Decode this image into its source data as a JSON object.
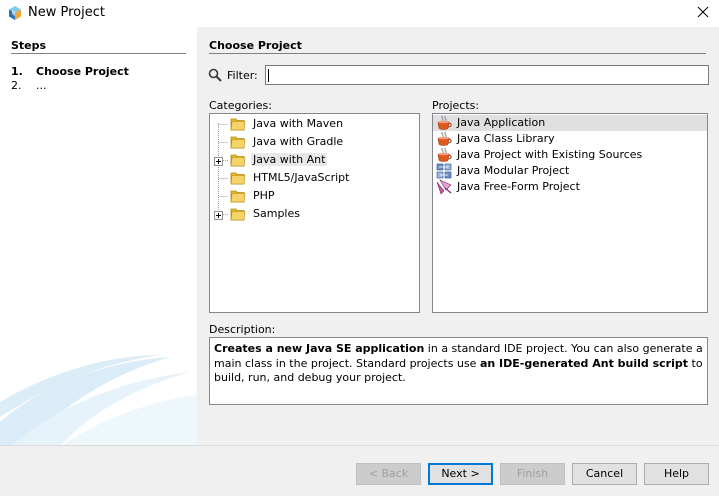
{
  "window": {
    "title": "New Project",
    "icons": {
      "app": "netbeans-cube-icon",
      "close": "close-icon"
    }
  },
  "steps": {
    "title": "Steps",
    "items": [
      {
        "num": "1.",
        "label": "Choose Project",
        "active": true
      },
      {
        "num": "2.",
        "label": "...",
        "active": false
      }
    ]
  },
  "main": {
    "section_title": "Choose Project",
    "filter": {
      "label": "Filter:",
      "value": "",
      "icon": "search-icon"
    },
    "categories_label": "Categories:",
    "projects_label": "Projects:",
    "categories": [
      {
        "label": "Java with Maven",
        "expandable": false,
        "selected": false
      },
      {
        "label": "Java with Gradle",
        "expandable": false,
        "selected": false
      },
      {
        "label": "Java with Ant",
        "expandable": true,
        "selected": true
      },
      {
        "label": "HTML5/JavaScript",
        "expandable": false,
        "selected": false
      },
      {
        "label": "PHP",
        "expandable": false,
        "selected": false
      },
      {
        "label": "Samples",
        "expandable": true,
        "selected": false
      }
    ],
    "projects": [
      {
        "label": "Java Application",
        "icon": "coffee-cup-icon",
        "selected": true
      },
      {
        "label": "Java Class Library",
        "icon": "coffee-cup-icon",
        "selected": false
      },
      {
        "label": "Java Project with Existing Sources",
        "icon": "coffee-cup-icon",
        "selected": false
      },
      {
        "label": "Java Modular Project",
        "icon": "modules-icon",
        "selected": false
      },
      {
        "label": "Java Free-Form Project",
        "icon": "freeform-icon",
        "selected": false
      }
    ],
    "description_label": "Description:",
    "description": {
      "p1": "Creates a new Java SE application",
      "p2": " in a standard IDE project. You can also generate a main class in the project. Standard projects use ",
      "p3": "an IDE-generated Ant build script",
      "p4": " to build, run, and debug your project."
    }
  },
  "buttons": {
    "back": "< Back",
    "next": "Next >",
    "finish": "Finish",
    "cancel": "Cancel",
    "help": "Help"
  },
  "colors": {
    "accent": "#0078d7",
    "selection": "#e0e0e0",
    "folder": "#e8b923"
  }
}
